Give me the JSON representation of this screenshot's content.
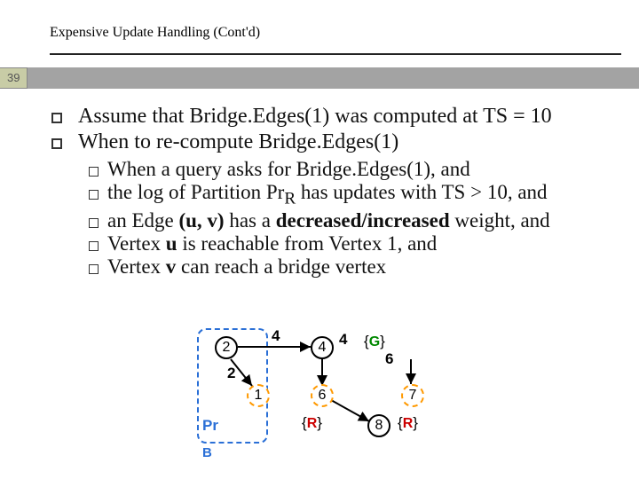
{
  "slide": {
    "number": "39",
    "title": "Expensive Update Handling (Cont'd)"
  },
  "points": {
    "p1": "Assume that Bridge.Edges(1) was computed at TS = 10",
    "p2": "When to re-compute Bridge.Edges(1)",
    "sub": {
      "s1": "When a query asks for Bridge.Edges(1), and",
      "s2_pre": "the log of Partition Pr",
      "s2_sub": "R",
      "s2_post": " has updates with TS > 10, and",
      "s3_pre": "an Edge ",
      "s3_uv": "(u, v)",
      "s3_mid": " has a ",
      "s3_emph": "decreased/increased",
      "s3_post": " weight, and",
      "s4_pre": "Vertex ",
      "s4_u": "u",
      "s4_post": " is reachable from Vertex 1, and",
      "s5_pre": "Vertex ",
      "s5_v": "v",
      "s5_post": " can reach a bridge vertex"
    }
  },
  "diagram": {
    "nodes": {
      "n2": "2",
      "n4a": "4",
      "n4b": "4",
      "n1": "1",
      "n6": "6",
      "n7": "7",
      "n8": "8"
    },
    "edges": {
      "w2": "2",
      "w6": "6"
    },
    "tags": {
      "R1": "R",
      "R2": "R",
      "G": "G"
    },
    "partition_label": "Pr",
    "boundary_label": "B"
  }
}
